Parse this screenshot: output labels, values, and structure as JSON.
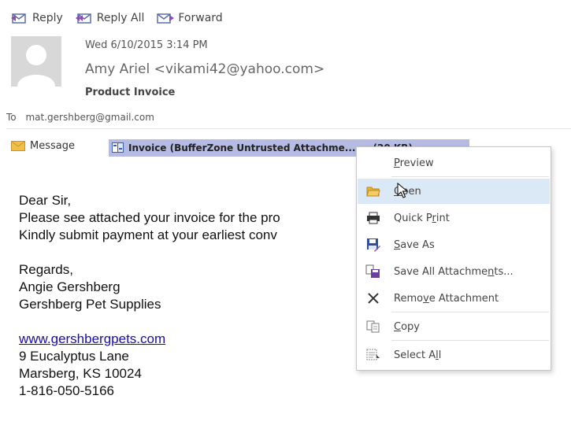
{
  "actions": [
    {
      "label": "Reply",
      "icon": "reply-icon"
    },
    {
      "label": "Reply All",
      "icon": "reply-all-icon"
    },
    {
      "label": "Forward",
      "icon": "forward-icon"
    }
  ],
  "header": {
    "date": "Wed 6/10/2015 3:14 PM",
    "sender": "Amy Ariel <vikami42@yahoo.com>",
    "subject": "Product Invoice",
    "to_label": "To",
    "to_value": "mat.gershberg@gmail.com"
  },
  "attachments_bar": {
    "message_label": "Message",
    "attachment_label": "Invoice (BufferZone Untrusted Attachme... ...   (20 KB)"
  },
  "body": {
    "lines": [
      "Dear Sir,",
      "Please see attached your invoice for the pro",
      "Kindly submit payment at your earliest conv"
    ],
    "signature": [
      "Regards,",
      "Angie Gershberg",
      "Gershberg Pet Supplies"
    ],
    "link": "www.gershbergpets.com",
    "address": [
      "9 Eucalyptus Lane",
      "Marsberg, KS 10024",
      "1-816-050-5166"
    ]
  },
  "context_menu": {
    "items": [
      {
        "pre": "",
        "key": "P",
        "post": "review",
        "icon": null
      },
      {
        "pre": "",
        "key": "O",
        "post": "pen",
        "icon": "folder-open-icon"
      },
      {
        "pre": "Quick P",
        "key": "r",
        "post": "int",
        "icon": "printer-icon"
      },
      {
        "pre": "",
        "key": "S",
        "post": "ave As",
        "icon": "save-as-icon"
      },
      {
        "pre": "Save All Attachme",
        "key": "n",
        "post": "ts...",
        "icon": "save-all-icon"
      },
      {
        "pre": "Remo",
        "key": "v",
        "post": "e Attachment",
        "icon": "remove-icon"
      },
      {
        "pre": "",
        "key": "C",
        "post": "opy",
        "icon": "copy-icon"
      },
      {
        "pre": "Select A",
        "key": "l",
        "post": "l",
        "icon": "select-all-icon"
      }
    ],
    "highlight_color": "#dbe8f6"
  },
  "colors": {
    "attachment_bg": "#b6bbe4",
    "link": "#1a0dab"
  }
}
